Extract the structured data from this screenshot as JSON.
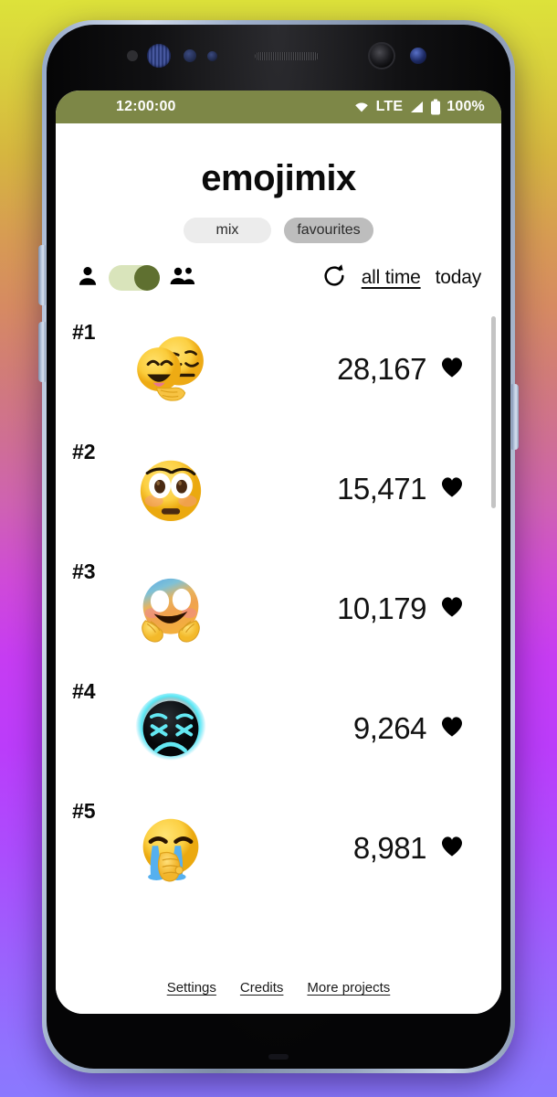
{
  "status_bar": {
    "time": "12:00:00",
    "network_label": "LTE",
    "battery_percent": "100%",
    "wifi_icon": "wifi-icon",
    "signal_icon": "signal-bars-icon",
    "battery_icon": "battery-full-icon",
    "background_color": "#7d8747"
  },
  "app": {
    "title": "emojimix"
  },
  "mode_tabs": [
    {
      "id": "mix",
      "label": "mix",
      "selected": false,
      "color": "#ececec"
    },
    {
      "id": "favourites",
      "label": "favourites",
      "selected": true,
      "color": "#bdbdbd"
    }
  ],
  "controls": {
    "single_person_icon": "person-icon",
    "group_person_icon": "people-icon",
    "audience_switch": {
      "name": "audience-toggle",
      "state": "on",
      "track_color": "#d9e4bb",
      "thumb_color": "#5f7030"
    },
    "refresh_icon": "refresh-icon",
    "ranges": [
      {
        "id": "all-time",
        "label": "all time",
        "active": true
      },
      {
        "id": "today",
        "label": "today",
        "active": false
      }
    ]
  },
  "leaderboard": {
    "heart_icon": "heart-icon",
    "rows": [
      {
        "rank": "#1",
        "score": "28,167",
        "emoji_name": "grinning-face-mixed-with-thinking-face"
      },
      {
        "rank": "#2",
        "score": "15,471",
        "emoji_name": "flushed-face-with-wide-eyes"
      },
      {
        "rank": "#3",
        "score": "10,179",
        "emoji_name": "hugging-face-rainbow-gradient"
      },
      {
        "rank": "#4",
        "score": "9,264",
        "emoji_name": "dark-persevering-face-cyan"
      },
      {
        "rank": "#5",
        "score": "8,981",
        "emoji_name": "loudly-crying-face-with-fist"
      }
    ]
  },
  "footer": {
    "links": [
      {
        "id": "settings",
        "label": "Settings"
      },
      {
        "id": "credits",
        "label": "Credits"
      },
      {
        "id": "more-projects",
        "label": "More projects"
      }
    ]
  },
  "theme": {
    "background_gradient_stops": [
      "#dde23a",
      "#d68a62",
      "#cf62b2",
      "#c63cf2",
      "#8a79fe"
    ],
    "accent_olive": "#7d8747",
    "screen_background": "#ffffff"
  }
}
